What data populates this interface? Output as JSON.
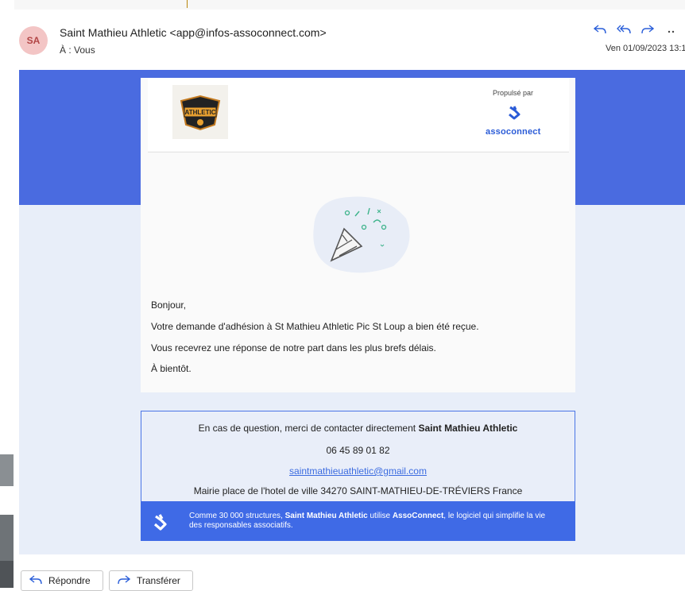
{
  "header": {
    "avatar_initials": "SA",
    "sender": "Saint Mathieu Athletic <app@infos-assoconnect.com>",
    "to": "À : Vous",
    "date": "Ven 01/09/2023 13:1",
    "actions": [
      "reply-icon",
      "reply-all-icon",
      "forward-icon",
      "more-icon"
    ]
  },
  "card": {
    "propulse": "Propulsé par",
    "brand": "assoconnect",
    "club_logo_text": "ATHLETIC",
    "message": {
      "greeting": "Bonjour,",
      "line1": "Votre demande d'adhésion à St Mathieu Athletic Pic St Loup a bien été reçue.",
      "line2": "Vous recevrez une réponse de notre part dans les plus brefs délais.",
      "closing": "À bientôt."
    }
  },
  "contact": {
    "intro": "En cas de question, merci de contacter directement ",
    "name": "Saint Mathieu Athletic",
    "phone": "06 45 89 01 82",
    "email": "saintmathieuathletic@gmail.com",
    "address": "Mairie place de l'hotel de ville 34270 SAINT-MATHIEU-DE-TRÉVIERS France"
  },
  "promo": {
    "t1": "Comme 30 000 structures, ",
    "t2": "Saint Mathieu Athletic",
    "t3": " utilise ",
    "t4": "AssoConnect",
    "t5": ", le logiciel qui simplifie la vie des responsables associatifs."
  },
  "buttons": {
    "reply": "Répondre",
    "forward": "Transférer"
  },
  "colors": {
    "accent": "#2b5fd9",
    "band": "#4a6be0",
    "light": "#e8eef9"
  }
}
